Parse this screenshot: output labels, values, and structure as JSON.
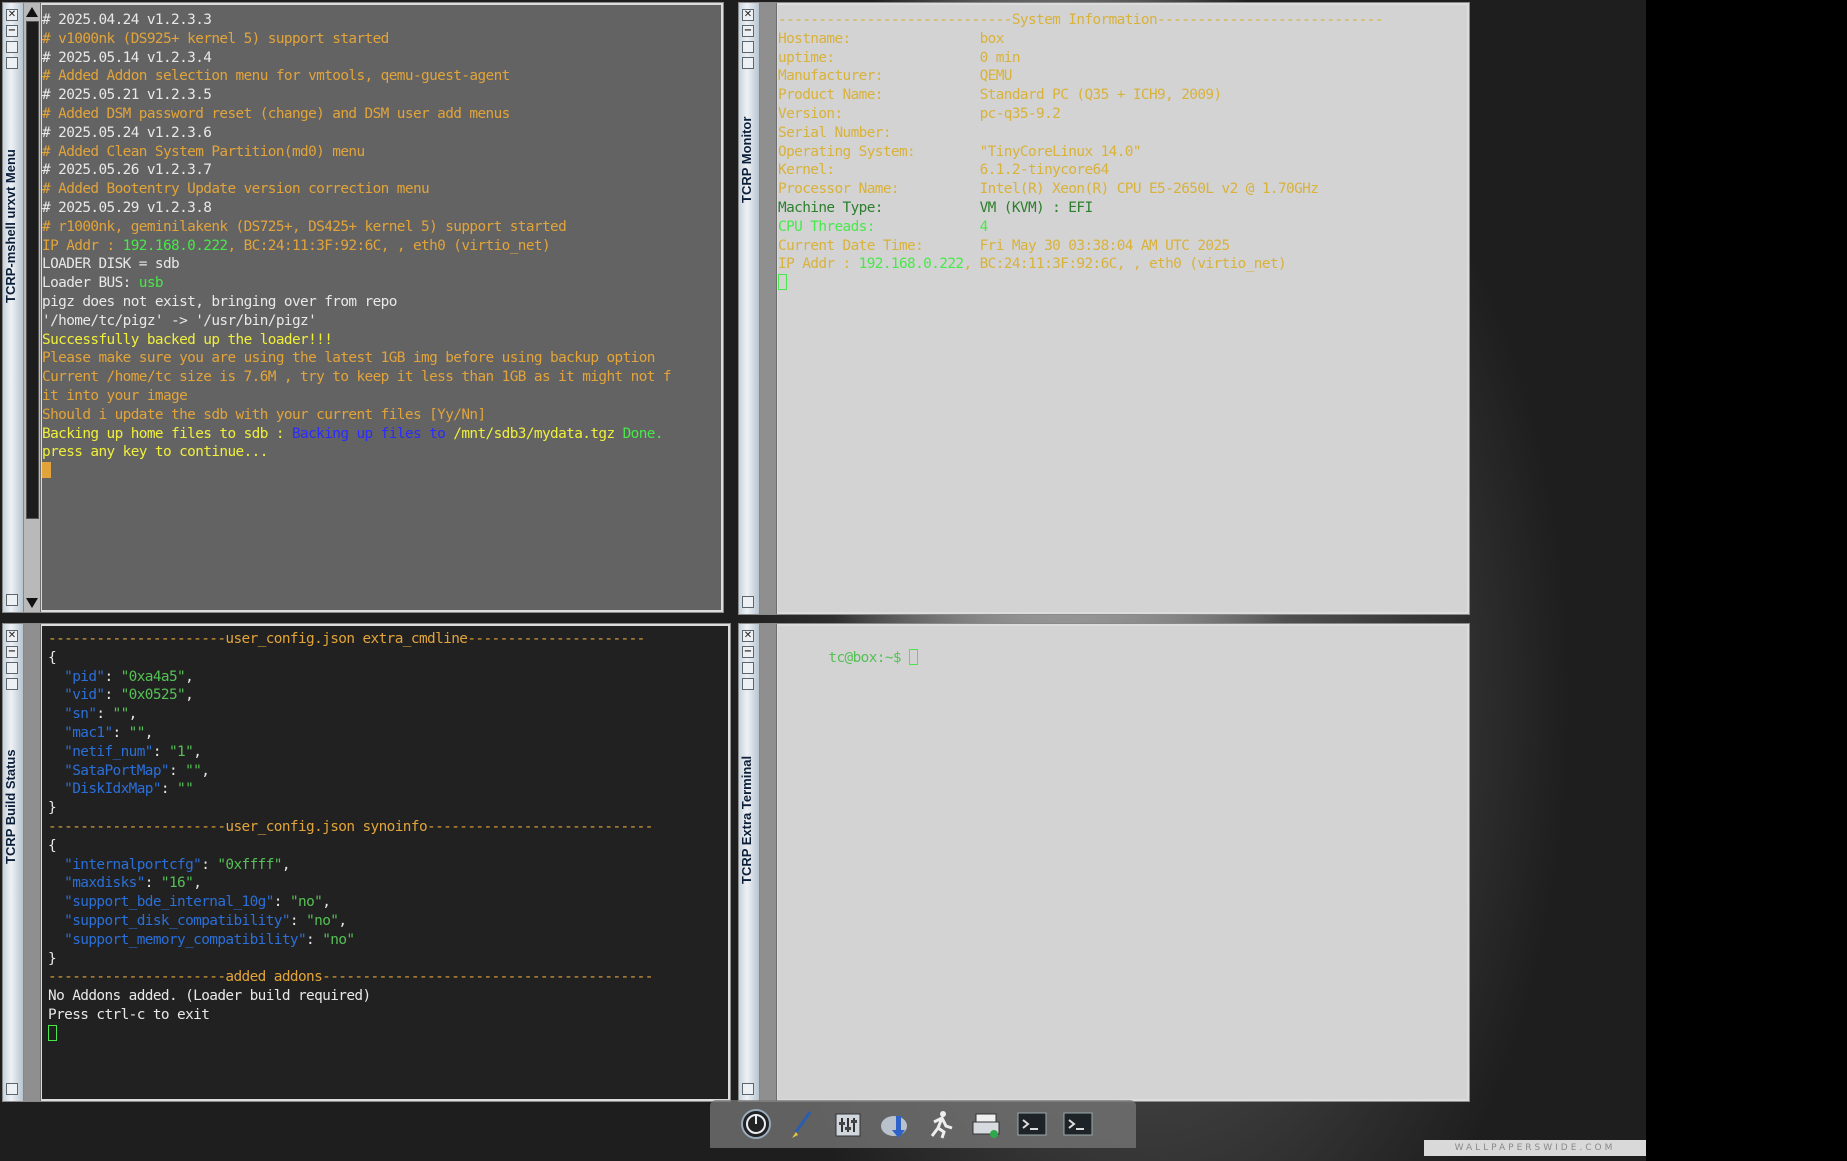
{
  "windows": {
    "top_left": {
      "title": "TCRP-mshell urxvt Menu",
      "lines": [
        [
          {
            "t": "# 2025.04.24 v1.2.3.3",
            "c": "w"
          }
        ],
        [
          {
            "t": "# v1000nk (DS925+ kernel 5) support started",
            "c": "o"
          }
        ],
        [
          {
            "t": "",
            "c": "w"
          }
        ],
        [
          {
            "t": "# 2025.05.14 v1.2.3.4",
            "c": "w"
          }
        ],
        [
          {
            "t": "# Added Addon selection menu for vmtools, qemu-guest-agent",
            "c": "o"
          }
        ],
        [
          {
            "t": "",
            "c": "w"
          }
        ],
        [
          {
            "t": "# 2025.05.21 v1.2.3.5",
            "c": "w"
          }
        ],
        [
          {
            "t": "# Added DSM password reset (change) and DSM user add menus",
            "c": "o"
          }
        ],
        [
          {
            "t": "",
            "c": "w"
          }
        ],
        [
          {
            "t": "# 2025.05.24 v1.2.3.6",
            "c": "w"
          }
        ],
        [
          {
            "t": "# Added Clean System Partition(md0) menu",
            "c": "o"
          }
        ],
        [
          {
            "t": "",
            "c": "w"
          }
        ],
        [
          {
            "t": "# 2025.05.26 v1.2.3.7",
            "c": "w"
          }
        ],
        [
          {
            "t": "# Added Bootentry Update version correction menu",
            "c": "o"
          }
        ],
        [
          {
            "t": "",
            "c": "w"
          }
        ],
        [
          {
            "t": "# 2025.05.29 v1.2.3.8",
            "c": "w"
          }
        ],
        [
          {
            "t": "# r1000nk, geminilakenk (DS725+, DS425+ kernel 5) support started",
            "c": "o"
          }
        ],
        [
          {
            "t": "",
            "c": "w"
          }
        ],
        [
          {
            "t": "IP Addr : ",
            "c": "o"
          },
          {
            "t": "192.168.0.222",
            "c": "g"
          },
          {
            "t": ", BC:24:11:3F:92:6C, , eth0 (virtio_net)",
            "c": "o"
          }
        ],
        [
          {
            "t": "LOADER DISK = sdb",
            "c": "w"
          }
        ],
        [
          {
            "t": "Loader BUS: ",
            "c": "w"
          },
          {
            "t": "usb",
            "c": "g"
          }
        ],
        [
          {
            "t": "pigz does not exist, bringing over from repo",
            "c": "w"
          }
        ],
        [
          {
            "t": "'/home/tc/pigz' -> '/usr/bin/pigz'",
            "c": "w"
          }
        ],
        [
          {
            "t": "Successfully backed up the loader!!!",
            "c": "y"
          }
        ],
        [
          {
            "t": "Please make sure you are using the latest 1GB img before using backup option",
            "c": "o"
          }
        ],
        [
          {
            "t": "Current /home/tc size is 7.6M , try to keep it less than 1GB as it might not f",
            "c": "o"
          }
        ],
        [
          {
            "t": "it into your image",
            "c": "o"
          }
        ],
        [
          {
            "t": "Should i update the sdb with your current files [Yy/Nn]",
            "c": "o"
          }
        ],
        [
          {
            "t": "Backing up home files to sdb : ",
            "c": "y"
          },
          {
            "t": "Backing up files to ",
            "c": "b"
          },
          {
            "t": "/mnt/sdb3/mydata.tgz ",
            "c": "y"
          },
          {
            "t": "Done.",
            "c": "g"
          }
        ],
        [
          {
            "t": "",
            "c": "w"
          }
        ],
        [
          {
            "t": "press any key to continue...",
            "c": "y"
          }
        ]
      ]
    },
    "top_right": {
      "title": "TCRP Monitor",
      "lines": [
        [
          {
            "t": "-----------------------------System Information----------------------------",
            "c": "yo"
          }
        ],
        [
          {
            "t": "Hostname:                ",
            "c": "yo"
          },
          {
            "t": "box",
            "c": "yo"
          }
        ],
        [
          {
            "t": "uptime:                  ",
            "c": "yo"
          },
          {
            "t": "0 min",
            "c": "yo"
          }
        ],
        [
          {
            "t": "Manufacturer:            ",
            "c": "yo"
          },
          {
            "t": "QEMU",
            "c": "yo"
          }
        ],
        [
          {
            "t": "Product Name:            ",
            "c": "yo"
          },
          {
            "t": "Standard PC (Q35 + ICH9, 2009)",
            "c": "yo"
          }
        ],
        [
          {
            "t": "Version:                 ",
            "c": "yo"
          },
          {
            "t": "pc-q35-9.2",
            "c": "yo"
          }
        ],
        [
          {
            "t": "Serial Number:",
            "c": "yo"
          }
        ],
        [
          {
            "t": "Operating System:        ",
            "c": "yo"
          },
          {
            "t": "\"TinyCoreLinux 14.0\"",
            "c": "yo"
          }
        ],
        [
          {
            "t": "Kernel:                  ",
            "c": "yo"
          },
          {
            "t": "6.1.2-tinycore64",
            "c": "yo"
          }
        ],
        [
          {
            "t": "Processor Name:          ",
            "c": "yo"
          },
          {
            "t": "Intel(R) Xeon(R) CPU E5-2650L v2 @ 1.70GHz",
            "c": "yo"
          }
        ],
        [
          {
            "t": "Machine Type:            ",
            "c": "dg"
          },
          {
            "t": "VM (KVM) : EFI",
            "c": "dg"
          }
        ],
        [
          {
            "t": "CPU Threads:             ",
            "c": "g"
          },
          {
            "t": "4",
            "c": "g"
          }
        ],
        [
          {
            "t": "Current Date Time:       ",
            "c": "yo"
          },
          {
            "t": "Fri May 30 03:38:04 AM UTC 2025",
            "c": "yo"
          }
        ],
        [
          {
            "t": "IP Addr : ",
            "c": "yo"
          },
          {
            "t": "192.168.0.222",
            "c": "g"
          },
          {
            "t": ", BC:24:11:3F:92:6C, , eth0 (virtio_net)",
            "c": "yo"
          }
        ]
      ]
    },
    "bottom_left": {
      "title": "TCRP Build Status",
      "lines": [
        [
          {
            "t": "----------------------user_config.json extra_cmdline----------------------",
            "c": "o"
          }
        ],
        [
          {
            "t": "{",
            "c": "w"
          }
        ],
        [
          {
            "t": "  \"pid\"",
            "c": "bl"
          },
          {
            "t": ": ",
            "c": "w"
          },
          {
            "t": "\"0xa4a5\"",
            "c": "gl"
          },
          {
            "t": ",",
            "c": "w"
          }
        ],
        [
          {
            "t": "  \"vid\"",
            "c": "bl"
          },
          {
            "t": ": ",
            "c": "w"
          },
          {
            "t": "\"0x0525\"",
            "c": "gl"
          },
          {
            "t": ",",
            "c": "w"
          }
        ],
        [
          {
            "t": "  \"sn\"",
            "c": "bl"
          },
          {
            "t": ": ",
            "c": "w"
          },
          {
            "t": "\"\"",
            "c": "gl"
          },
          {
            "t": ",",
            "c": "w"
          }
        ],
        [
          {
            "t": "  \"mac1\"",
            "c": "bl"
          },
          {
            "t": ": ",
            "c": "w"
          },
          {
            "t": "\"\"",
            "c": "gl"
          },
          {
            "t": ",",
            "c": "w"
          }
        ],
        [
          {
            "t": "  \"netif_num\"",
            "c": "bl"
          },
          {
            "t": ": ",
            "c": "w"
          },
          {
            "t": "\"1\"",
            "c": "gl"
          },
          {
            "t": ",",
            "c": "w"
          }
        ],
        [
          {
            "t": "  \"SataPortMap\"",
            "c": "bl"
          },
          {
            "t": ": ",
            "c": "w"
          },
          {
            "t": "\"\"",
            "c": "gl"
          },
          {
            "t": ",",
            "c": "w"
          }
        ],
        [
          {
            "t": "  \"DiskIdxMap\"",
            "c": "bl"
          },
          {
            "t": ": ",
            "c": "w"
          },
          {
            "t": "\"\"",
            "c": "gl"
          }
        ],
        [
          {
            "t": "}",
            "c": "w"
          }
        ],
        [
          {
            "t": "----------------------user_config.json synoinfo----------------------------",
            "c": "o"
          }
        ],
        [
          {
            "t": "{",
            "c": "w"
          }
        ],
        [
          {
            "t": "  \"internalportcfg\"",
            "c": "bl"
          },
          {
            "t": ": ",
            "c": "w"
          },
          {
            "t": "\"0xffff\"",
            "c": "gl"
          },
          {
            "t": ",",
            "c": "w"
          }
        ],
        [
          {
            "t": "  \"maxdisks\"",
            "c": "bl"
          },
          {
            "t": ": ",
            "c": "w"
          },
          {
            "t": "\"16\"",
            "c": "gl"
          },
          {
            "t": ",",
            "c": "w"
          }
        ],
        [
          {
            "t": "  \"support_bde_internal_10g\"",
            "c": "bl"
          },
          {
            "t": ": ",
            "c": "w"
          },
          {
            "t": "\"no\"",
            "c": "gl"
          },
          {
            "t": ",",
            "c": "w"
          }
        ],
        [
          {
            "t": "  \"support_disk_compatibility\"",
            "c": "bl"
          },
          {
            "t": ": ",
            "c": "w"
          },
          {
            "t": "\"no\"",
            "c": "gl"
          },
          {
            "t": ",",
            "c": "w"
          }
        ],
        [
          {
            "t": "  \"support_memory_compatibility\"",
            "c": "bl"
          },
          {
            "t": ": ",
            "c": "w"
          },
          {
            "t": "\"no\"",
            "c": "gl"
          }
        ],
        [
          {
            "t": "}",
            "c": "w"
          }
        ],
        [
          {
            "t": "----------------------added addons-----------------------------------------",
            "c": "o"
          }
        ],
        [
          {
            "t": "No Addons added. (Loader build required)",
            "c": "w"
          }
        ],
        [
          {
            "t": "Press ctrl-c to exit",
            "c": "w"
          }
        ]
      ]
    },
    "bottom_right": {
      "title": "TCRP Extra Terminal",
      "prompt": "tc@box:~$ "
    }
  },
  "taskbar": {
    "icons": [
      "power-icon",
      "brush-icon",
      "control-panel-icon",
      "mount-icon",
      "run-icon",
      "installer-icon",
      "terminal-icon",
      "terminal-icon-2"
    ]
  },
  "wallpaper_mark": "WALLPAPERSWIDE.COM"
}
